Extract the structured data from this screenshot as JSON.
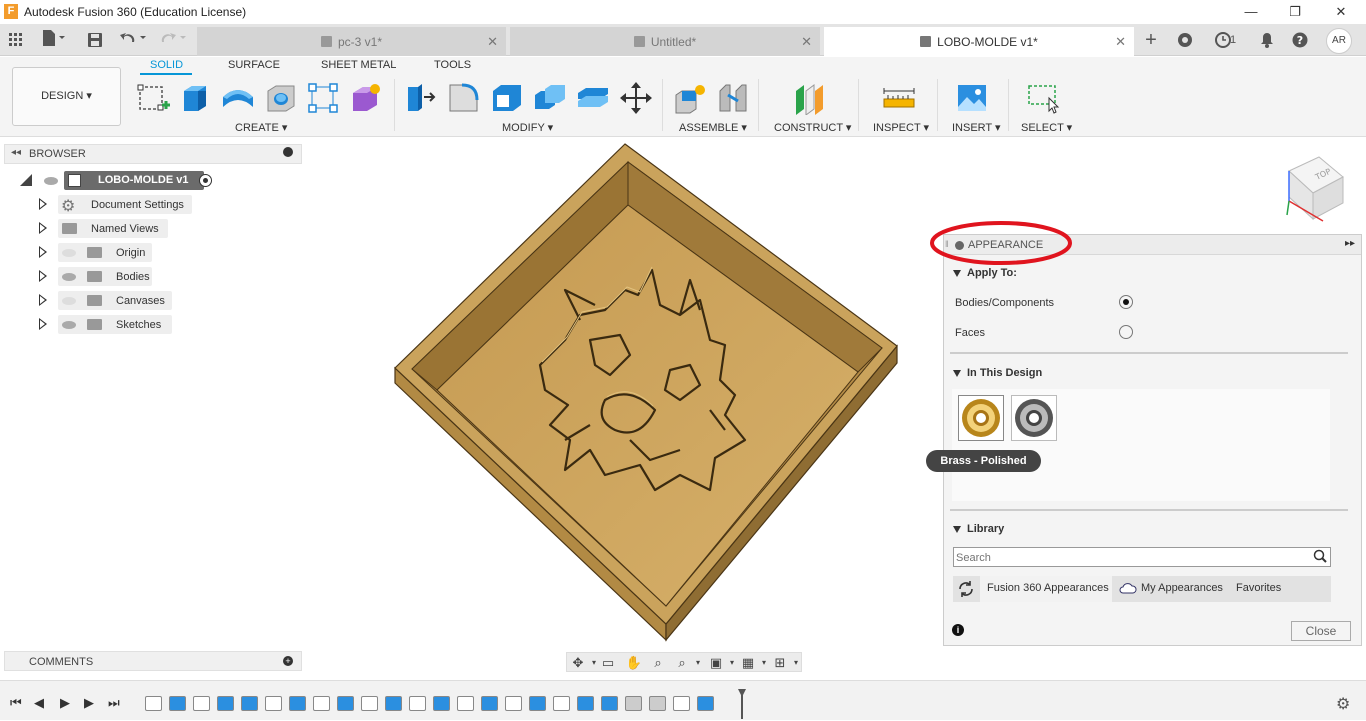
{
  "window": {
    "title": "Autodesk Fusion 360 (Education License)",
    "app_icon": "F",
    "minimize": "—",
    "restore": "❐",
    "close": "✕"
  },
  "tabs": [
    {
      "label": "pc-3 v1*",
      "active": false
    },
    {
      "label": "Untitled*",
      "active": false
    },
    {
      "label": "LOBO-MOLDE v1*",
      "active": true
    }
  ],
  "tabbar": {
    "job_count": "1",
    "avatar": "AR"
  },
  "toolbar": {
    "workspace": "DESIGN",
    "workspace_tabs": [
      "SOLID",
      "SURFACE",
      "SHEET METAL",
      "TOOLS"
    ],
    "groups": [
      "CREATE",
      "MODIFY",
      "ASSEMBLE",
      "CONSTRUCT",
      "INSPECT",
      "INSERT",
      "SELECT"
    ]
  },
  "browser": {
    "title": "BROWSER",
    "root": "LOBO-MOLDE v1",
    "items": [
      "Document Settings",
      "Named Views",
      "Origin",
      "Bodies",
      "Canvases",
      "Sketches"
    ]
  },
  "comments": {
    "title": "COMMENTS"
  },
  "appearance": {
    "title": "APPEARANCE",
    "apply_to": {
      "title": "Apply To:",
      "options": [
        "Bodies/Components",
        "Faces"
      ],
      "selected": "Bodies/Components"
    },
    "in_this_design": {
      "title": "In This Design"
    },
    "tooltip": "Brass - Polished",
    "library": {
      "title": "Library",
      "search_placeholder": "Search",
      "tabs": [
        "Fusion 360 Appearances",
        "My Appearances",
        "Favorites"
      ]
    },
    "close": "Close"
  },
  "viewcube": {
    "face": "TOP"
  },
  "colors": {
    "accent": "#0696d7",
    "highlight_ring": "#e0141e",
    "model_brass": "#c9a35a"
  }
}
